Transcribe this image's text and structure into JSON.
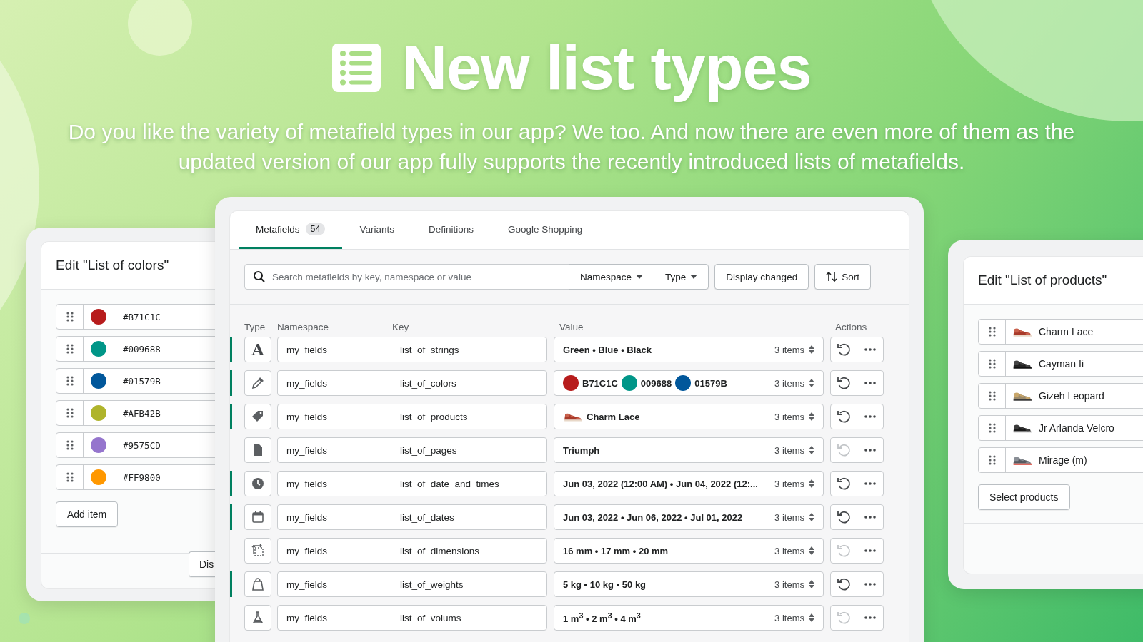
{
  "banner": {
    "title": "New list types",
    "subtitle": "Do you like the variety of metafield types in our app? We too. And now there are even more of them as the updated version of our app fully supports the recently introduced lists of metafields."
  },
  "colors_editor": {
    "title": "Edit \"List of colors\"",
    "items": [
      {
        "value": "#B71C1C",
        "color": "#b71c1c"
      },
      {
        "value": "#009688",
        "color": "#009688"
      },
      {
        "value": "#01579B",
        "color": "#01579b"
      },
      {
        "value": "#AFB42B",
        "color": "#afb42b"
      },
      {
        "value": "#9575CD",
        "color": "#9575cd"
      },
      {
        "value": "#FF9800",
        "color": "#ff9800"
      }
    ],
    "add_button": "Add item",
    "footer_button": "Dis"
  },
  "metafields": {
    "tabs": [
      {
        "label": "Metafields",
        "count": "54",
        "selected": true
      },
      {
        "label": "Variants",
        "selected": false
      },
      {
        "label": "Definitions",
        "selected": false
      },
      {
        "label": "Google Shopping",
        "selected": false
      }
    ],
    "search": {
      "placeholder": "Search metafields by key, namespace or value"
    },
    "filters": [
      "Namespace",
      "Type"
    ],
    "display_button": "Display changed",
    "sort_button": "Sort",
    "columns": [
      "Type",
      "Namespace",
      "Key",
      "Value",
      "Actions"
    ],
    "rows": [
      {
        "kind": "text",
        "type_glyph": "A",
        "namespace": "my_fields",
        "key": "list_of_strings",
        "changed": true,
        "value": {
          "kind": "text",
          "text": "Green • Blue • Black"
        },
        "count": "3 items"
      },
      {
        "kind": "color",
        "namespace": "my_fields",
        "key": "list_of_colors",
        "changed": true,
        "value": {
          "kind": "colors",
          "items": [
            {
              "label": "B71C1C",
              "color": "#b71c1c"
            },
            {
              "label": "009688",
              "color": "#009688"
            },
            {
              "label": "01579B",
              "color": "#01579b"
            }
          ]
        },
        "count": "3 items"
      },
      {
        "kind": "product",
        "namespace": "my_fields",
        "key": "list_of_products",
        "changed": true,
        "value": {
          "kind": "product",
          "text": "Charm Lace"
        },
        "count": "3 items"
      },
      {
        "kind": "page",
        "namespace": "my_fields",
        "key": "list_of_pages",
        "changed": false,
        "value": {
          "kind": "text",
          "text": "Triumph"
        },
        "count": "3 items"
      },
      {
        "kind": "datetime",
        "namespace": "my_fields",
        "key": "list_of_date_and_times",
        "changed": true,
        "value": {
          "kind": "text",
          "text": "Jun 03, 2022 (12:00 AM) • Jun 04, 2022 (12:..."
        },
        "count": "3 items"
      },
      {
        "kind": "date",
        "namespace": "my_fields",
        "key": "list_of_dates",
        "changed": true,
        "value": {
          "kind": "text",
          "text": "Jun 03, 2022 • Jun 06, 2022 • Jul 01, 2022"
        },
        "count": "3 items"
      },
      {
        "kind": "dimension",
        "namespace": "my_fields",
        "key": "list_of_dimensions",
        "changed": false,
        "value": {
          "kind": "text",
          "text": "16 mm • 17 mm • 20 mm"
        },
        "count": "3 items"
      },
      {
        "kind": "weight",
        "namespace": "my_fields",
        "key": "list_of_weights",
        "changed": true,
        "value": {
          "kind": "text",
          "text": "5 kg • 10 kg • 50 kg"
        },
        "count": "3 items"
      },
      {
        "kind": "volume",
        "namespace": "my_fields",
        "key": "list_of_volums",
        "changed": false,
        "value": {
          "kind": "text",
          "text": "1 m$^{3}$ • 2 m$^{3}$ • 4 m$^{3}$"
        },
        "count": "3 items"
      }
    ]
  },
  "products_editor": {
    "title": "Edit \"List of products\"",
    "items": [
      "Charm Lace",
      "Cayman Ii",
      "Gizeh Leopard",
      "Jr Arlanda Velcro",
      "Mirage (m)"
    ],
    "select_button": "Select products"
  }
}
